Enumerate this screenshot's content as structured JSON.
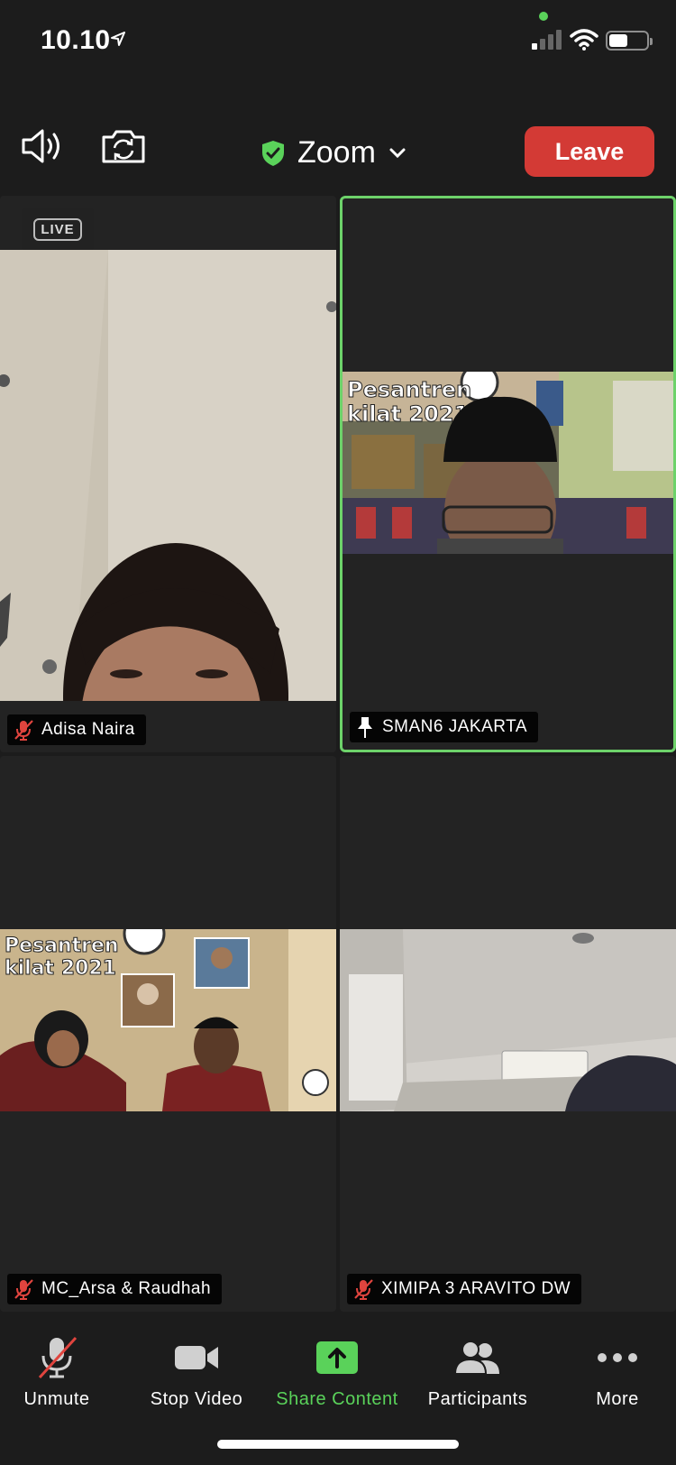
{
  "status_bar": {
    "time": "10.10",
    "icons": [
      "location-arrow-icon",
      "cellular-signal-icon",
      "wifi-icon",
      "battery-icon"
    ]
  },
  "top_bar": {
    "title": "Zoom",
    "leave_label": "Leave",
    "icons": [
      "speaker-icon",
      "switch-camera-icon",
      "shield-check-icon",
      "chevron-down-icon"
    ],
    "accent_color": "#6dd26a",
    "leave_color": "#d33a35"
  },
  "participants": [
    {
      "name": "Adisa Naira",
      "status": "muted",
      "badge": "LIVE"
    },
    {
      "name": "SMAN6 JAKARTA",
      "status": "pinned",
      "active_speaker": true
    },
    {
      "name": "MC_Arsa & Raudhah",
      "status": "muted"
    },
    {
      "name": "XIMIPA 3 ARAVITO DW",
      "status": "muted"
    }
  ],
  "toolbar": {
    "items": [
      {
        "label": "Unmute",
        "icon": "mic-muted-icon"
      },
      {
        "label": "Stop Video",
        "icon": "video-camera-icon"
      },
      {
        "label": "Share Content",
        "icon": "share-arrow-icon"
      },
      {
        "label": "Participants",
        "icon": "participants-icon"
      },
      {
        "label": "More",
        "icon": "more-dots-icon"
      }
    ],
    "share_color": "#5ad25a"
  }
}
